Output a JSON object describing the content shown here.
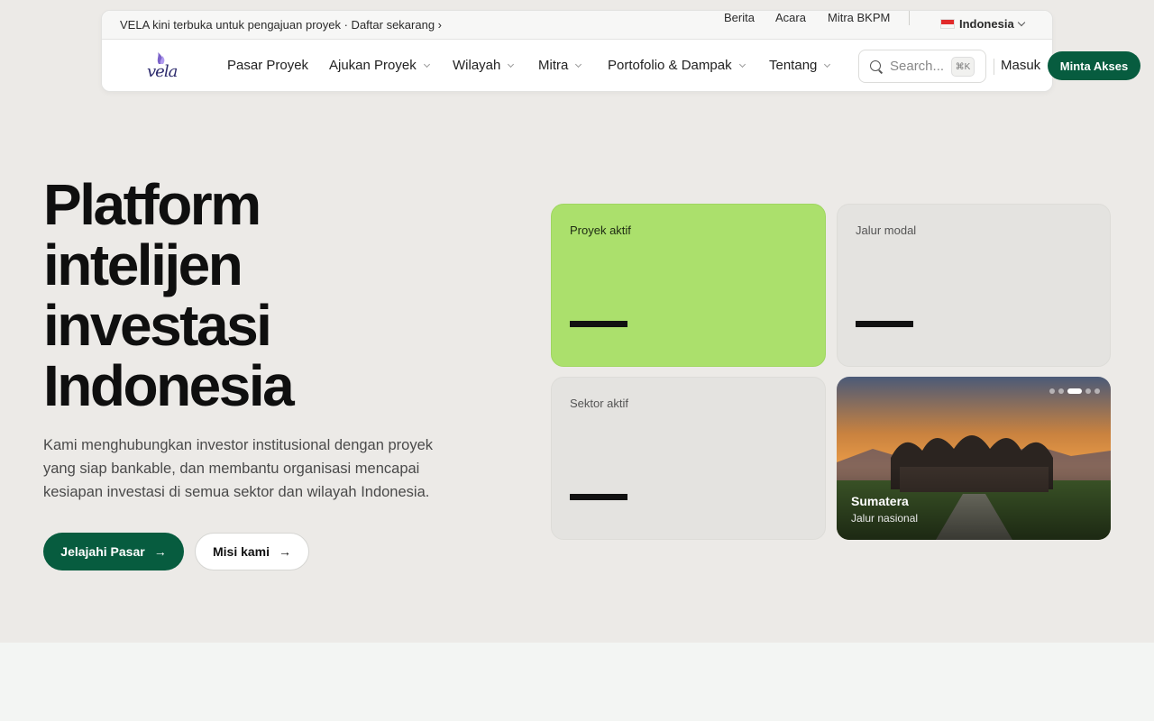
{
  "topbar": {
    "announcement": "VELA kini terbuka untuk pengajuan proyek · Daftar sekarang ›",
    "links": [
      "Berita",
      "Acara",
      "Mitra BKPM"
    ],
    "language": "Indonesia"
  },
  "logo": {
    "text": "vela"
  },
  "nav": {
    "items": [
      {
        "label": "Pasar Proyek"
      },
      {
        "label": "Ajukan Proyek"
      },
      {
        "label": "Wilayah"
      },
      {
        "label": "Mitra"
      },
      {
        "label": "Portofolio & Dampak"
      },
      {
        "label": "Tentang"
      }
    ],
    "search_placeholder": "Search...",
    "search_shortcut": "⌘K",
    "login": "Masuk",
    "cta": "Minta Akses"
  },
  "hero": {
    "title_lines": [
      "Platform",
      "intelijen",
      "investasi",
      "Indonesia"
    ],
    "description": "Kami menghubungkan investor institusional dengan proyek yang siap bankable, dan membantu organisasi mencapai kesiapan investasi di semua sektor dan wilayah Indonesia.",
    "primary_button": "Jelajahi Pasar",
    "secondary_button": "Misi kami"
  },
  "cards": {
    "active_projects": {
      "label": "Proyek aktif"
    },
    "capital_pipeline": {
      "label": "Jalur modal"
    },
    "active_sectors": {
      "label": "Sektor aktif"
    },
    "region": {
      "title": "Sumatera",
      "subtitle": "Jalur nasional",
      "slide_active": 3,
      "slide_count": 5
    }
  },
  "colors": {
    "brand_green": "#075c3f",
    "card_lime": "#abe06c",
    "background": "#eceae7"
  }
}
